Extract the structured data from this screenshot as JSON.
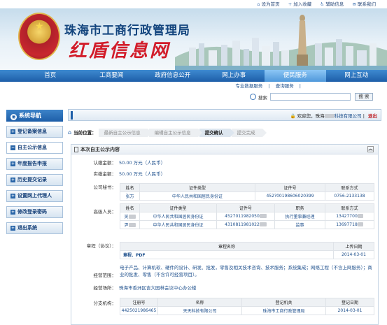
{
  "top_links": [
    {
      "icon": "home-icon",
      "label": "设为首页"
    },
    {
      "icon": "star-icon",
      "label": "加入收藏"
    },
    {
      "icon": "accessibility-icon",
      "label": "辅助信息"
    },
    {
      "icon": "mail-icon",
      "label": "联系我们"
    }
  ],
  "header": {
    "portal_name": "珠海市工商行政管理局",
    "slogan": "红盾信息网"
  },
  "nav": {
    "items": [
      "首页",
      "工商要闻",
      "政府信息公开",
      "网上办事",
      "便民服务",
      "网上互动"
    ],
    "active_index": 4
  },
  "subnav": {
    "items": [
      "专业数据服务",
      "|",
      "查询服务",
      "|"
    ]
  },
  "search": {
    "label": "搜索",
    "placeholder": "",
    "button": "搜 索"
  },
  "sidebar": {
    "title": "系统导航",
    "items": [
      {
        "label": "登记备案信息",
        "icon": "plus-box-icon"
      },
      {
        "label": "自主公示信息",
        "icon": "minus-box-icon"
      },
      {
        "label": "年度报告申报",
        "icon": "plus-box-icon"
      },
      {
        "label": "历史提交记录",
        "icon": "plus-box-icon"
      },
      {
        "label": "设置网上代理人",
        "icon": "plus-box-icon"
      },
      {
        "label": "修改登录密码",
        "icon": "plus-box-icon"
      },
      {
        "label": "退出系统",
        "icon": "plus-box-icon"
      }
    ],
    "active_index": 1
  },
  "welcome": {
    "text": "欢迎您，珠海",
    "company_suffix": "科技有限公司",
    "logout": "退出"
  },
  "breadcrumb": {
    "label": "当前位置：",
    "steps": [
      "最新自主公示信息",
      "编辑自主公示信息",
      "提交确认",
      "提交完成"
    ],
    "current_index": 2
  },
  "panel": {
    "title": "本次自主公示内容",
    "subscribed": {
      "label": "认缴金额：",
      "value": "50.00  万元（人民币）"
    },
    "paid": {
      "label": "实缴金额：",
      "value": "50.00  万元（人民币）"
    },
    "secretary": {
      "label": "公司秘书：",
      "headers": [
        "姓名",
        "证件类型",
        "证件号",
        "联系方式"
      ],
      "rows": [
        [
          "张万",
          "中华人民共和国居民身份证",
          "452?00198606020399",
          "0756-2133138"
        ]
      ]
    },
    "executives": {
      "label": "高级人员：",
      "headers": [
        "姓名",
        "证件类型",
        "证件号",
        "职务",
        "联系方式"
      ],
      "rows": [
        [
          "吴",
          "中华人民共和国居民身份证",
          "4527011982050",
          "执行董事兼经理",
          "13427700"
        ],
        [
          "尹",
          "中华人民共和国居民身份证",
          "4310811981022",
          "监事",
          "13697718"
        ]
      ]
    },
    "charter": {
      "label": "章程（协议）：",
      "headers": [
        "章程名称",
        "上传日期"
      ],
      "rows": [
        [
          "章程．PDF",
          "2014-03-01"
        ]
      ]
    },
    "scope": {
      "label": "经营范围：",
      "value": "电子产品、计算机软、硬件的设计、研发、批发，零售及相关技术咨询、技术服务；系统集成；网络工程（不含上网服务）；商业的批发、零售（不含许可经营项目）。"
    },
    "address": {
      "label": "经营场所：",
      "value": "珠海市香洲区吉大园林会议中心办公楼"
    },
    "branch": {
      "label": "分支机构：",
      "headers": [
        "注册号",
        "名称",
        "登记机关",
        "登记日期"
      ],
      "rows": [
        [
          "4425021986465",
          "天天科技有限公司",
          "珠海市工商行政管理局",
          "2014-03-01"
        ]
      ]
    }
  },
  "colors": {
    "brand_blue": "#1d5ea8",
    "slogan_red": "#d21c2a",
    "active_tab": "#6fb0ec"
  }
}
